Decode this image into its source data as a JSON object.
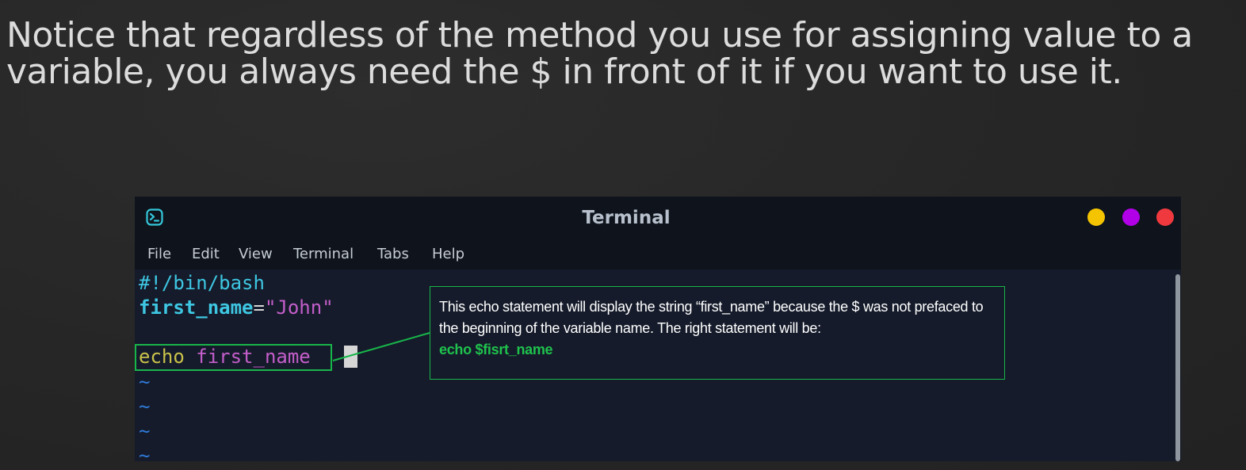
{
  "slide": {
    "title_line1": "Notice that regardless of the method you use for assigning value to a",
    "title_line2": "variable, you always need the $ in front of it if you want to use it."
  },
  "window": {
    "title": "Terminal",
    "app_icon": "terminal-icon",
    "controls": {
      "minimize_color": "#f5c400",
      "maximize_color": "#b100e8",
      "close_color": "#f0393f"
    }
  },
  "menu": {
    "file": "File",
    "edit": "Edit",
    "view": "View",
    "terminal": "Terminal",
    "tabs": "Tabs",
    "help": "Help"
  },
  "editor": {
    "shebang": "#!/bin/bash",
    "assign_var": "first_name",
    "assign_op": "=",
    "assign_value": "\"John\"",
    "echo_keyword": "echo",
    "echo_arg": "first_name",
    "empty_line_marker": "~"
  },
  "callout": {
    "text": "This echo statement will display the string “first_name” because the $ was not prefaced to the beginning of the variable name. The right statement will be:",
    "code": "echo $fisrt_name"
  },
  "colors": {
    "highlight": "#18b54a",
    "background": "#262626",
    "editor_bg": "#151b2a",
    "titlebar_bg": "#0f141c"
  }
}
